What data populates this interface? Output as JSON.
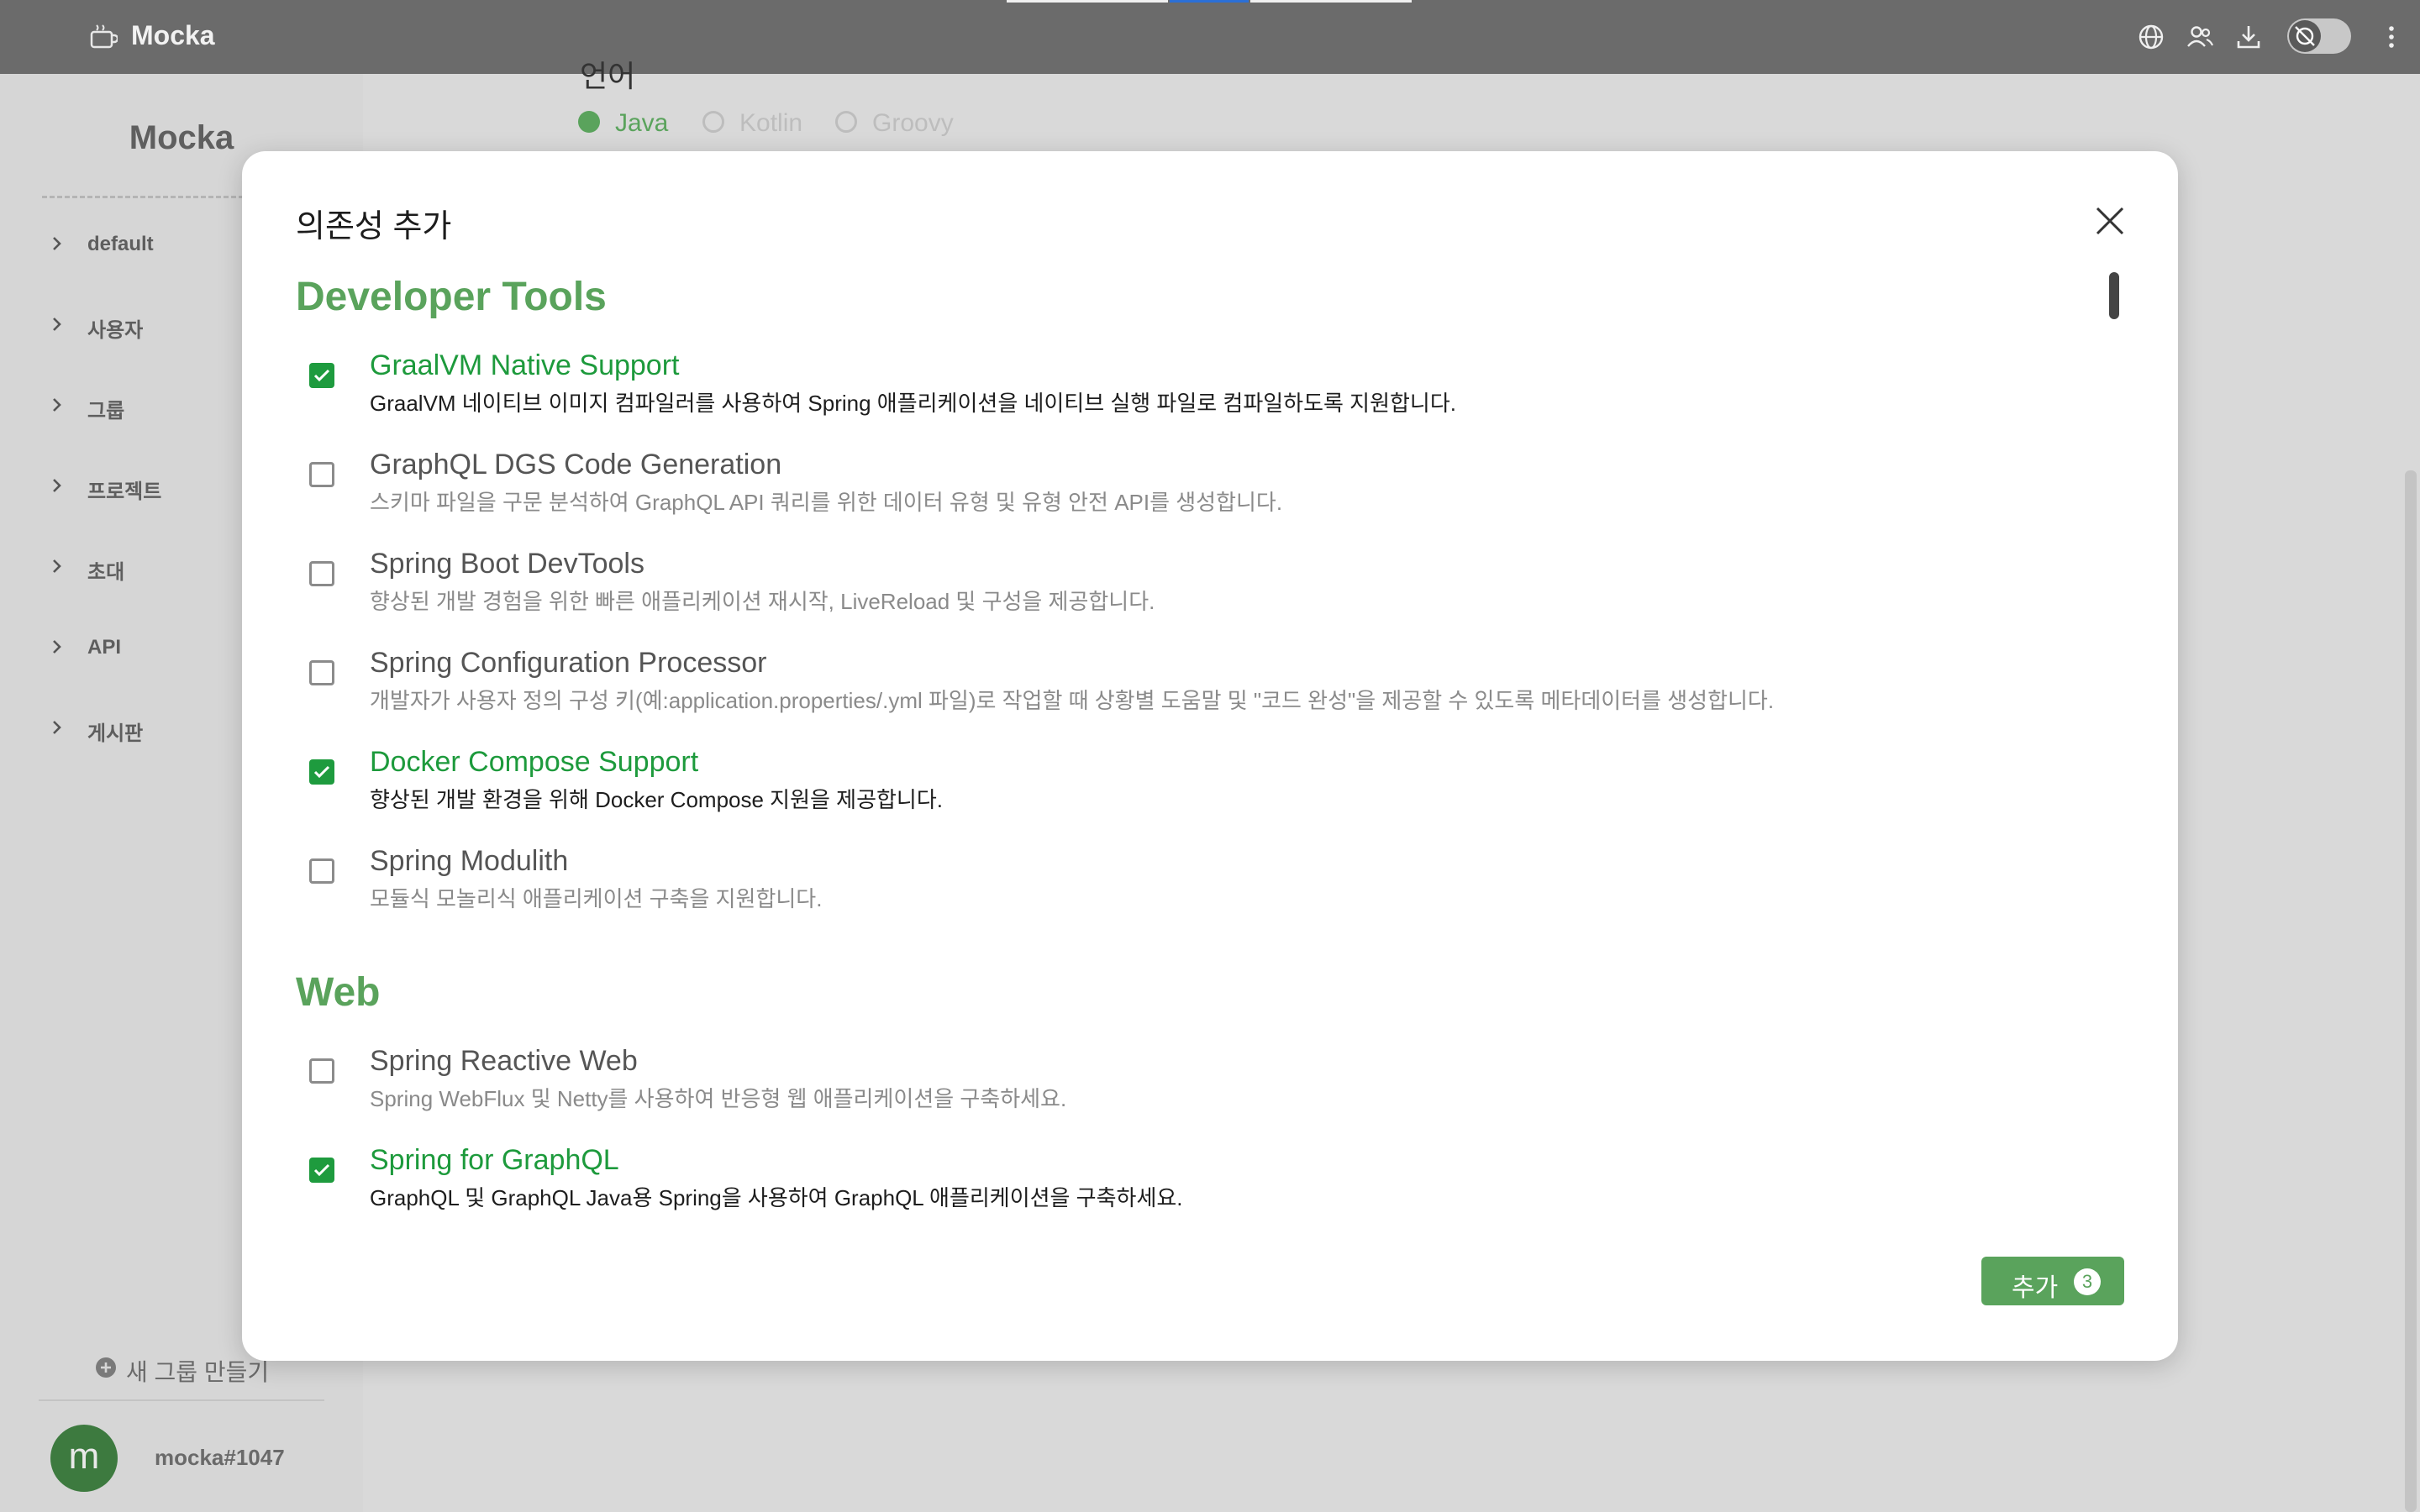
{
  "header": {
    "title": "Mocka",
    "icons": [
      "globe-icon",
      "users-icon",
      "download-icon",
      "theme-toggle",
      "more-vertical-icon"
    ]
  },
  "sidebar": {
    "title": "Mocka",
    "items": [
      {
        "label": "default"
      },
      {
        "label": "사용자"
      },
      {
        "label": "그룹"
      },
      {
        "label": "프로젝트"
      },
      {
        "label": "초대"
      },
      {
        "label": "API"
      },
      {
        "label": "게시판"
      }
    ],
    "new_group_label": "새 그룹 만들기",
    "user": {
      "avatar_letter": "m",
      "name": "mocka#1047"
    }
  },
  "background_page": {
    "heading": "언어",
    "radio_options": [
      {
        "label": "Java",
        "selected": true
      },
      {
        "label": "Kotlin",
        "selected": false
      },
      {
        "label": "Groovy",
        "selected": false
      }
    ]
  },
  "modal": {
    "title": "의존성 추가",
    "sections": [
      {
        "title": "Developer Tools",
        "items": [
          {
            "name": "GraalVM Native Support",
            "desc": "GraalVM 네이티브 이미지 컴파일러를 사용하여 Spring 애플리케이션을 네이티브 실행 파일로 컴파일하도록 지원합니다.",
            "checked": true
          },
          {
            "name": "GraphQL DGS Code Generation",
            "desc": "스키마 파일을 구문 분석하여 GraphQL API 쿼리를 위한 데이터 유형 및 유형 안전 API를 생성합니다.",
            "checked": false
          },
          {
            "name": "Spring Boot DevTools",
            "desc": "향상된 개발 경험을 위한 빠른 애플리케이션 재시작, LiveReload 및 구성을 제공합니다.",
            "checked": false
          },
          {
            "name": "Spring Configuration Processor",
            "desc": "개발자가 사용자 정의 구성 키(예:application.properties/.yml 파일)로 작업할 때 상황별 도움말 및 \"코드 완성\"을 제공할 수 있도록 메타데이터를 생성합니다.",
            "checked": false
          },
          {
            "name": "Docker Compose Support",
            "desc": "향상된 개발 환경을 위해 Docker Compose 지원을 제공합니다.",
            "checked": true
          },
          {
            "name": "Spring Modulith",
            "desc": "모듈식 모놀리식 애플리케이션 구축을 지원합니다.",
            "checked": false
          }
        ]
      },
      {
        "title": "Web",
        "items": [
          {
            "name": "Spring Reactive Web",
            "desc": "Spring WebFlux 및 Netty를 사용하여 반응형 웹 애플리케이션을 구축하세요.",
            "checked": false
          },
          {
            "name": "Spring for GraphQL",
            "desc": "GraphQL 및 GraphQL Java용 Spring을 사용하여 GraphQL 애플리케이션을 구축하세요.",
            "checked": true
          }
        ]
      }
    ],
    "add_button": {
      "label": "추가",
      "count": "3"
    }
  },
  "colors": {
    "accent": "#5aa35c",
    "checkbox_checked": "#1e9b3e",
    "topbar": "#6b6b6b",
    "overlay_bg": "#d9d9d9"
  }
}
